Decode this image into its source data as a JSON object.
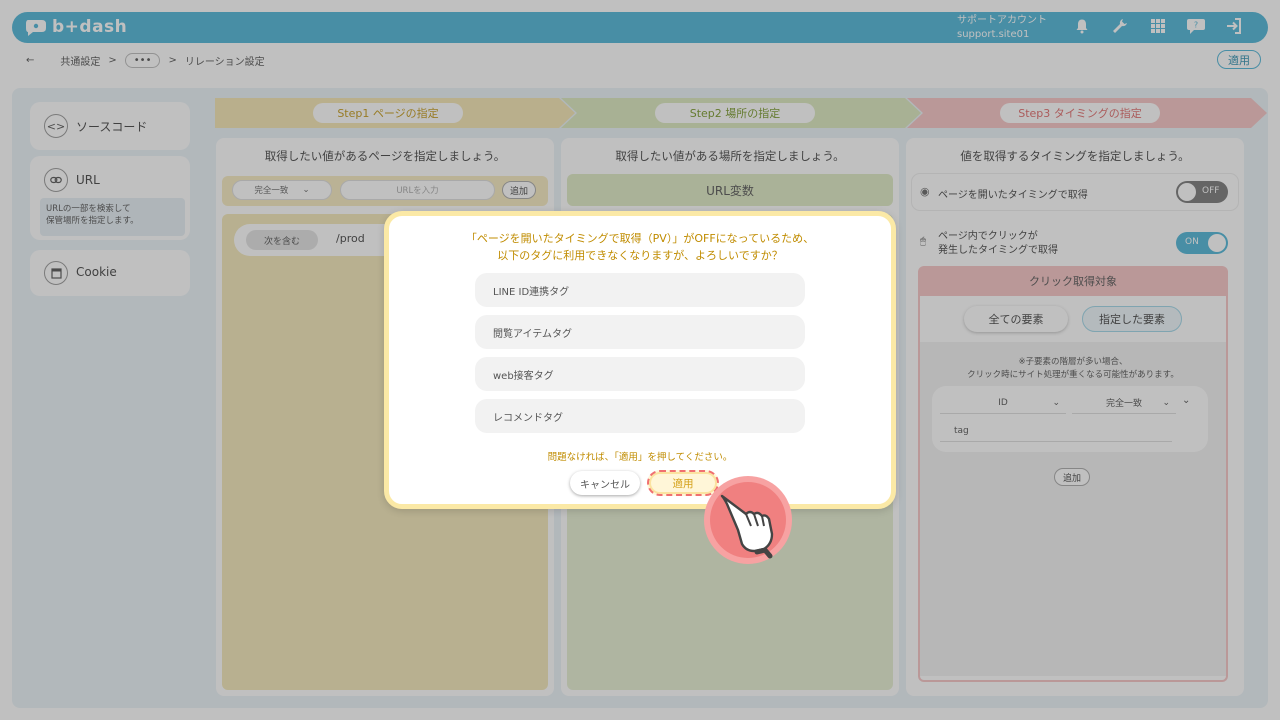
{
  "header": {
    "logo_text": "b+dash",
    "account_label": "サポートアカウント",
    "account_site": "support.site01",
    "icons": [
      "bell-icon",
      "wrench-icon",
      "grid-icon",
      "chat-icon",
      "logout-icon"
    ]
  },
  "breadcrumb": {
    "back_symbol": "←",
    "root": "共通設定",
    "sep1": ">",
    "dots": "•••",
    "sep2": ">",
    "current": "リレーション設定",
    "apply_label": "適用"
  },
  "sidebar": {
    "items": [
      {
        "label": "ソースコード",
        "icon": "code-icon"
      },
      {
        "label": "URL",
        "icon": "link-icon",
        "description_line1": "URLの一部を検索して",
        "description_line2": "保管場所を指定します。"
      },
      {
        "label": "Cookie",
        "icon": "window-icon"
      }
    ]
  },
  "steps": [
    {
      "label": "Step1 ページの指定",
      "color": "#f5e6b3",
      "text_color": "#c49a1a"
    },
    {
      "label": "Step2 場所の指定",
      "color": "#dce9bf",
      "text_color": "#7a9a2a"
    },
    {
      "label": "Step3 タイミングの指定",
      "color": "#f7c5c5",
      "text_color": "#e06b6b"
    }
  ],
  "col1": {
    "title": "取得したい値があるページを指定しましょう。",
    "match_select": "完全一致",
    "url_placeholder": "URLを入力",
    "add_label": "追加",
    "condition_tag": "次を含む",
    "condition_value": "/prod"
  },
  "col2": {
    "title": "取得したい値がある場所を指定しましょう。",
    "var_label": "URL変数"
  },
  "col3": {
    "title": "値を取得するタイミングを指定しましょう。",
    "pv_label": "ページを開いたタイミングで取得",
    "pv_toggle": "OFF",
    "click_label_line1": "ページ内でクリックが",
    "click_label_line2": "発生したタイミングで取得",
    "click_toggle": "ON",
    "click_target_header": "クリック取得対象",
    "all_elements": "全ての要素",
    "specified_elements": "指定した要素",
    "note_line1": "※子要素の階層が多い場合、",
    "note_line2": "クリック時にサイト処理が重くなる可能性があります。",
    "attr_select": "ID",
    "match_select": "完全一致",
    "tag_value": "tag",
    "add_label": "追加"
  },
  "modal": {
    "message_line1": "「ページを開いたタイミングで取得（PV）」がOFFになっているため、",
    "message_line2": "以下のタグに利用できなくなりますが、よろしいですか？",
    "tags": [
      "LINE ID連携タグ",
      "閲覧アイテムタグ",
      "web接客タグ",
      "レコメンドタグ"
    ],
    "note": "問題なければ、「適用」を押してください。",
    "cancel_label": "キャンセル",
    "apply_label": "適用"
  },
  "colors": {
    "brand": "#4fb6d8",
    "accent_text": "#c08c00",
    "highlight_ring": "#f07070"
  }
}
